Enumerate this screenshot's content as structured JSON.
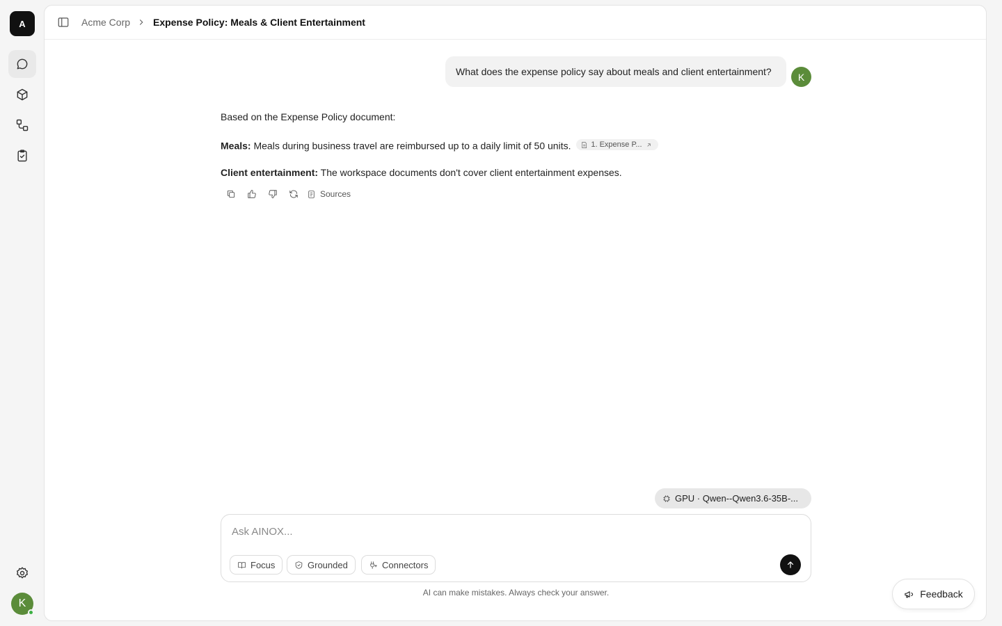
{
  "app": {
    "logo_letter": "A",
    "brand_color": "#111111",
    "avatar_color": "#5b8c3a",
    "online_color": "#3cb043"
  },
  "rail": {
    "items": [
      {
        "name": "chat",
        "icon": "chat-bubble-icon",
        "active": true
      },
      {
        "name": "models",
        "icon": "cube-icon",
        "active": false
      },
      {
        "name": "workflows",
        "icon": "workflow-icon",
        "active": false
      },
      {
        "name": "tasks",
        "icon": "clipboard-check-icon",
        "active": false
      }
    ],
    "settings_icon": "gear-icon",
    "user_initial": "K"
  },
  "breadcrumb": {
    "root": "Acme Corp",
    "current": "Expense Policy: Meals & Client Entertainment"
  },
  "conversation": {
    "user_message": "What does the expense policy say about meals and client entertainment?",
    "user_initial": "K",
    "answer": {
      "intro": "Based on the Expense Policy document:",
      "meals_label": "Meals:",
      "meals_text": "Meals during business travel are reimbursed up to a daily limit of 50 units.",
      "citation_label": "1. Expense P...",
      "client_label": "Client entertainment:",
      "client_text": "The workspace documents don't cover client entertainment expenses."
    },
    "actions": {
      "copy_icon": "copy-icon",
      "like_icon": "thumbs-up-icon",
      "dislike_icon": "thumbs-down-icon",
      "regenerate_icon": "refresh-icon",
      "sources_label": "Sources"
    }
  },
  "model_selector": {
    "label": "GPU · Qwen--Qwen3.6-35B-..."
  },
  "composer": {
    "placeholder": "Ask AINOX...",
    "value": "",
    "chips": {
      "focus": "Focus",
      "grounded": "Grounded",
      "connectors": "Connectors"
    }
  },
  "disclaimer": "AI can make mistakes. Always check your answer.",
  "feedback": {
    "label": "Feedback"
  }
}
